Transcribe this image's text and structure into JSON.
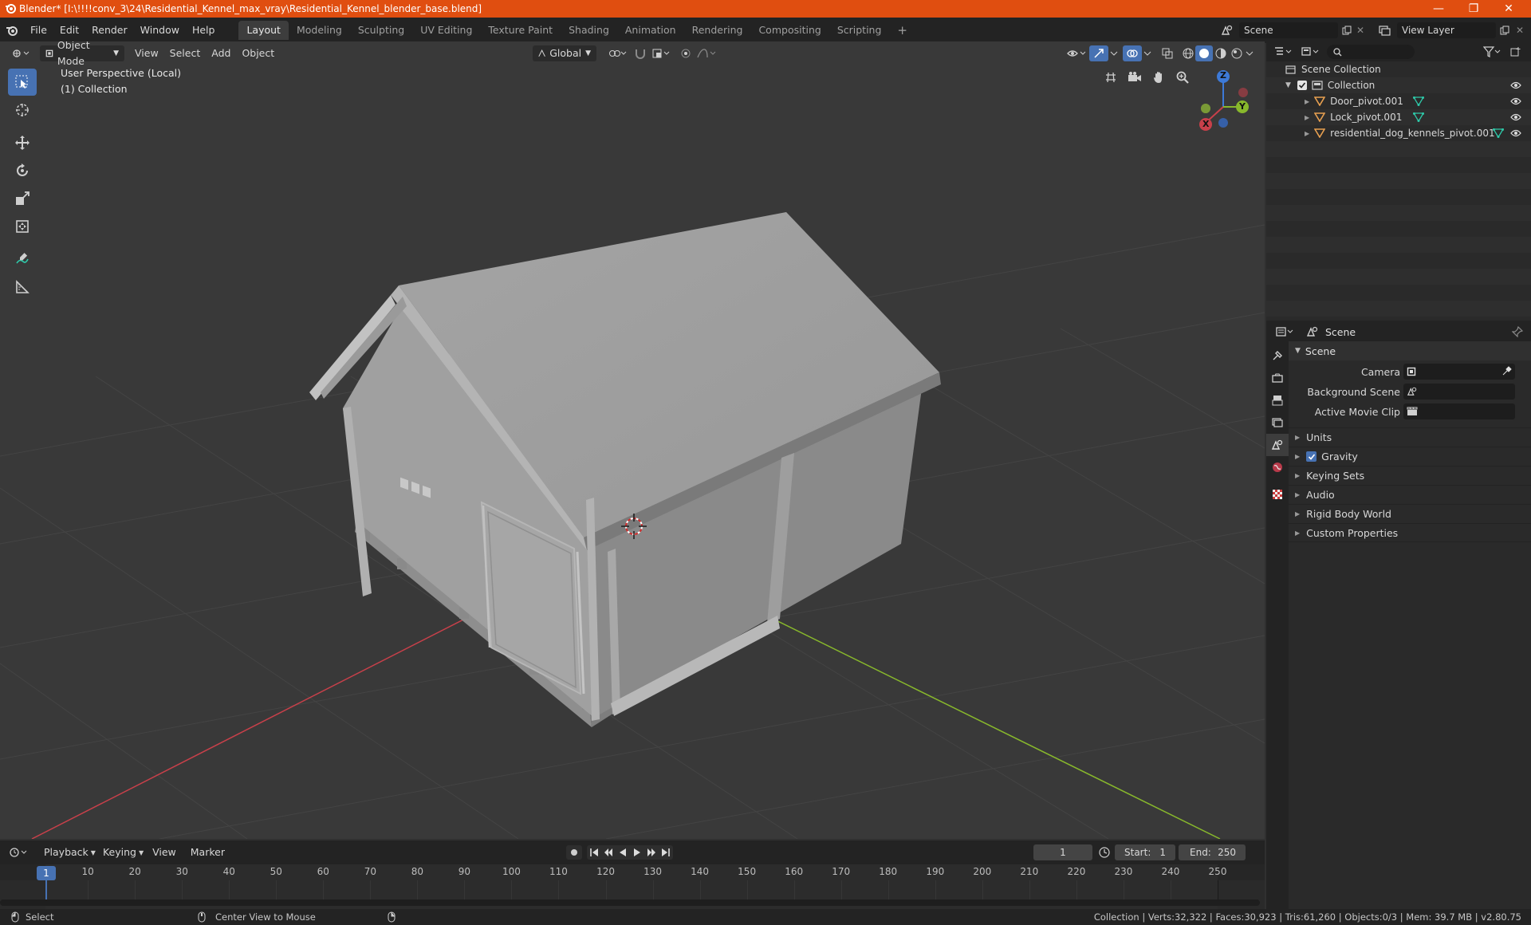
{
  "window": {
    "title": "Blender* [I:\\!!!!conv_3\\24\\Residential_Kennel_max_vray\\Residential_Kennel_blender_base.blend]"
  },
  "menu": [
    "File",
    "Edit",
    "Render",
    "Window",
    "Help"
  ],
  "workspaces": [
    "Layout",
    "Modeling",
    "Sculpting",
    "UV Editing",
    "Texture Paint",
    "Shading",
    "Animation",
    "Rendering",
    "Compositing",
    "Scripting"
  ],
  "active_workspace": "Layout",
  "scene_field": "Scene",
  "view_layer_field": "View Layer",
  "viewport": {
    "mode": "Object Mode",
    "menus": [
      "View",
      "Select",
      "Add",
      "Object"
    ],
    "transform_orientation": "Global",
    "overlay_line1": "User Perspective (Local)",
    "overlay_line2": "(1) Collection",
    "gizmo": {
      "x": "X",
      "y": "Y",
      "z": "Z"
    }
  },
  "outliner": {
    "root": "Scene Collection",
    "collection": "Collection",
    "objects": [
      "Door_pivot.001",
      "Lock_pivot.001",
      "residential_dog_kennels_pivot.001"
    ]
  },
  "properties": {
    "header": "Scene",
    "panel": "Scene",
    "fields": [
      {
        "label": "Camera"
      },
      {
        "label": "Background Scene"
      },
      {
        "label": "Active Movie Clip"
      }
    ],
    "sections": [
      "Units",
      "Gravity",
      "Keying Sets",
      "Audio",
      "Rigid Body World",
      "Custom Properties"
    ]
  },
  "timeline": {
    "menus": [
      "Playback",
      "Keying",
      "View",
      "Marker"
    ],
    "current_frame": "1",
    "start_label": "Start:",
    "start": "1",
    "end_label": "End:",
    "end": "250",
    "ticks": [
      "1",
      "10",
      "20",
      "30",
      "40",
      "50",
      "60",
      "70",
      "80",
      "90",
      "100",
      "110",
      "120",
      "130",
      "140",
      "150",
      "160",
      "170",
      "180",
      "190",
      "200",
      "210",
      "220",
      "230",
      "240",
      "250"
    ]
  },
  "status": {
    "left": "Select",
    "middle": "Center View to Mouse",
    "right": "Collection | Verts:32,322 | Faces:30,923 | Tris:61,260 | Objects:0/3 | Mem: 39.7 MB | v2.80.75"
  },
  "colors": {
    "titlebar": "#e04e10",
    "accent": "#4772b3",
    "x_axis": "#c8404a",
    "y_axis": "#88b82c",
    "z_axis": "#3d7ad8",
    "mesh_icon": "#2ec8a8",
    "object_icon": "#e8a050"
  }
}
